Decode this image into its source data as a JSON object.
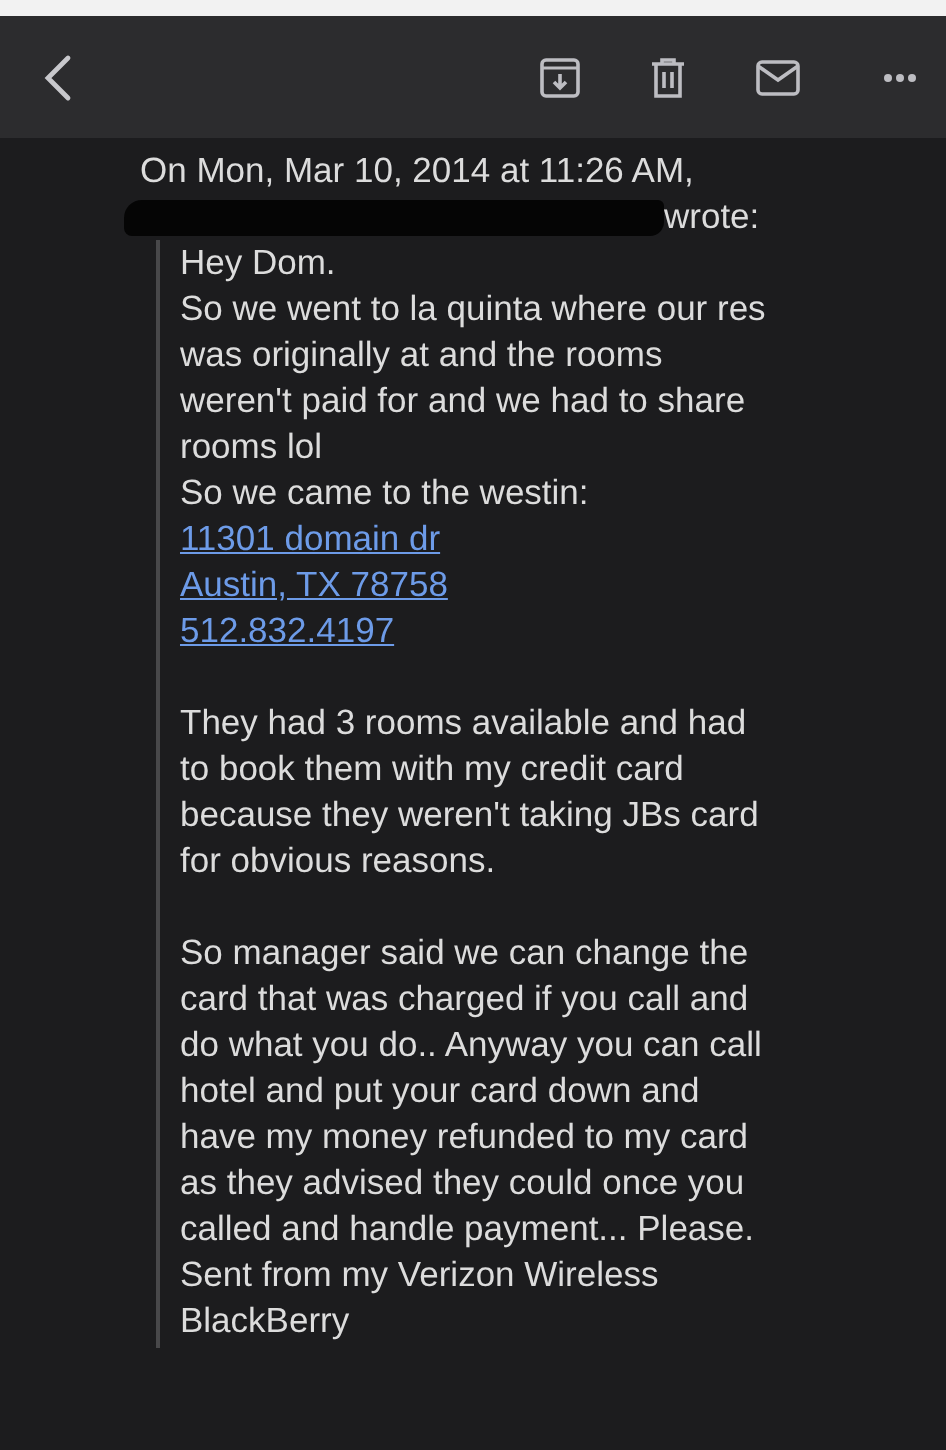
{
  "toolbar": {
    "actions": [
      {
        "kind": "archive"
      },
      {
        "kind": "trash"
      },
      {
        "kind": "mail"
      },
      {
        "kind": "more"
      }
    ]
  },
  "quote_header": {
    "date_line": "On Mon, Mar 10, 2014 at 11:26 AM,",
    "sender_redacted": true,
    "wrote": "wrote:"
  },
  "message_lines": [
    {
      "kind": "text",
      "text": "Hey Dom."
    },
    {
      "kind": "text",
      "text": "So we went to la quinta where our res"
    },
    {
      "kind": "text",
      "text": "was originally at and the rooms"
    },
    {
      "kind": "text",
      "text": "weren't paid for and we had to share"
    },
    {
      "kind": "text",
      "text": "rooms lol"
    },
    {
      "kind": "text",
      "text": "So we came to the westin:"
    },
    {
      "kind": "link",
      "text": "11301 domain dr"
    },
    {
      "kind": "link",
      "text": "Austin, TX 78758"
    },
    {
      "kind": "link",
      "text": "512.832.4197"
    },
    {
      "kind": "blank"
    },
    {
      "kind": "text",
      "text": "They had 3 rooms available and had"
    },
    {
      "kind": "text",
      "text": "to book them with my credit card"
    },
    {
      "kind": "text",
      "text": "because they weren't taking JBs card"
    },
    {
      "kind": "text",
      "text": "for obvious reasons."
    },
    {
      "kind": "blank"
    },
    {
      "kind": "text",
      "text": "So manager said we can change the"
    },
    {
      "kind": "text",
      "text": "card that was charged if you call and"
    },
    {
      "kind": "text",
      "text": "do what you do.. Anyway you can call"
    },
    {
      "kind": "text",
      "text": "hotel and put your card down and"
    },
    {
      "kind": "text",
      "text": "have my money refunded to my card"
    },
    {
      "kind": "text",
      "text": "as they advised they could once you"
    },
    {
      "kind": "text",
      "text": "called and handle payment... Please."
    },
    {
      "kind": "text",
      "text": "Sent from my Verizon Wireless"
    },
    {
      "kind": "text",
      "text": "BlackBerry"
    }
  ]
}
